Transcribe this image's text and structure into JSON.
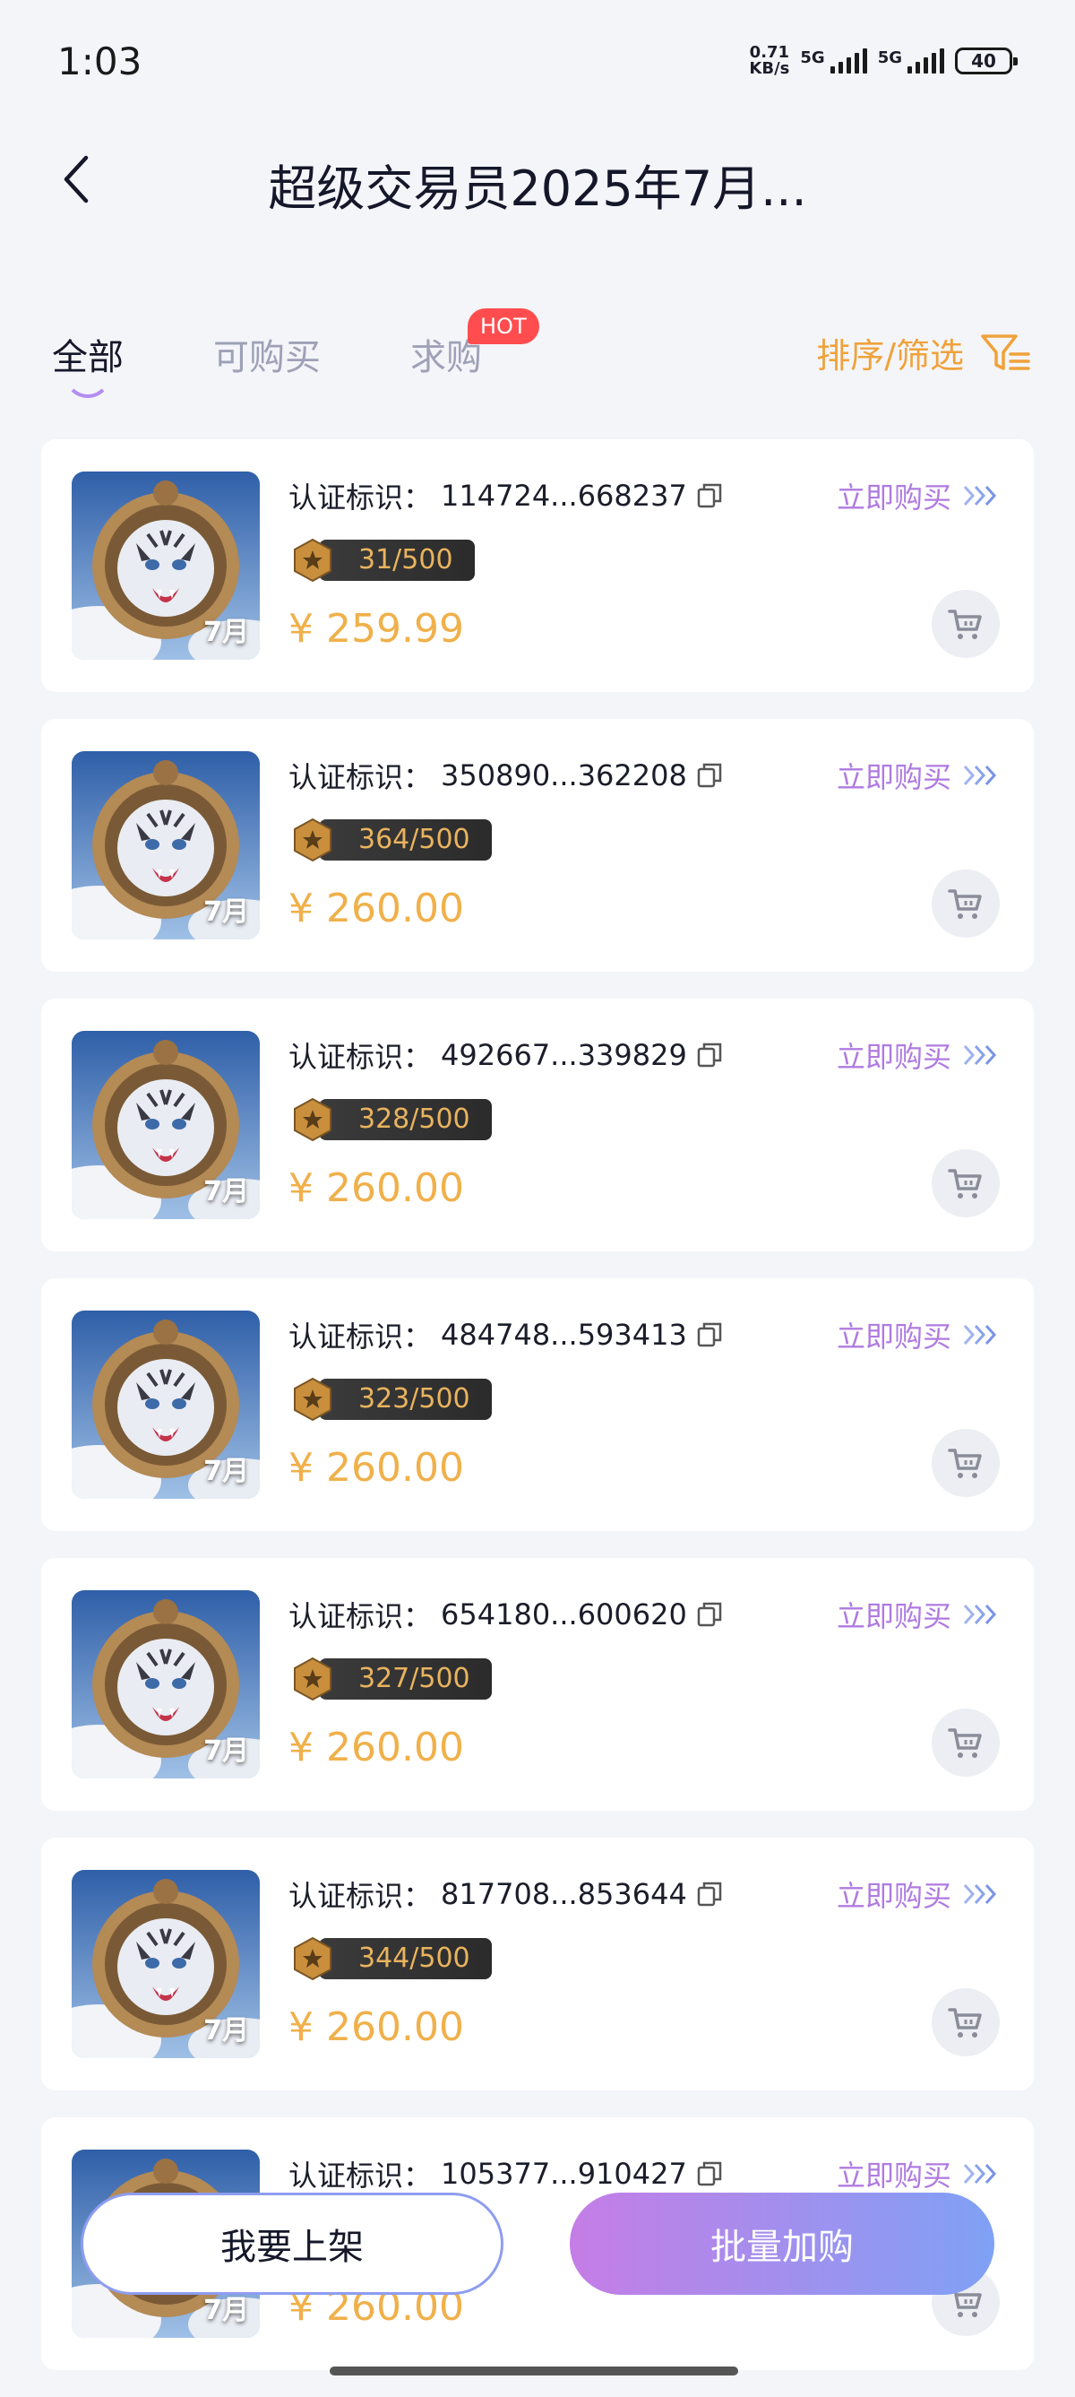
{
  "status": {
    "time": "1:03",
    "net_speed_value": "0.71",
    "net_speed_unit": "KB/s",
    "sim1_label": "5G",
    "sim2_label": "5G",
    "battery": "40"
  },
  "header": {
    "title": "超级交易员2025年7月..."
  },
  "tabs": [
    {
      "label": "全部",
      "active": true
    },
    {
      "label": "可购买",
      "active": false
    },
    {
      "label": "求购",
      "active": false
    }
  ],
  "hot_badge": "HOT",
  "sort_filter_label": "排序/筛选",
  "card_common": {
    "buy_now_label": "立即购买",
    "image_label": "7月",
    "cert_prefix": "认证标识："
  },
  "items": [
    {
      "cert_id": "114724...668237",
      "edition": "31/500",
      "price": "¥ 259.99"
    },
    {
      "cert_id": "350890...362208",
      "edition": "364/500",
      "price": "¥ 260.00"
    },
    {
      "cert_id": "492667...339829",
      "edition": "328/500",
      "price": "¥ 260.00"
    },
    {
      "cert_id": "484748...593413",
      "edition": "323/500",
      "price": "¥ 260.00"
    },
    {
      "cert_id": "654180...600620",
      "edition": "327/500",
      "price": "¥ 260.00"
    },
    {
      "cert_id": "817708...853644",
      "edition": "344/500",
      "price": "¥ 260.00"
    },
    {
      "cert_id": "105377...910427",
      "edition": "",
      "price": "¥ 260.00"
    }
  ],
  "bottom": {
    "list_button": "我要上架",
    "bulk_button": "批量加购"
  },
  "colors": {
    "accent_purple": "#b07be0",
    "price_gold": "#f0b04a",
    "hot_red": "#ff4d4f",
    "filter_orange": "#f0a23a"
  }
}
